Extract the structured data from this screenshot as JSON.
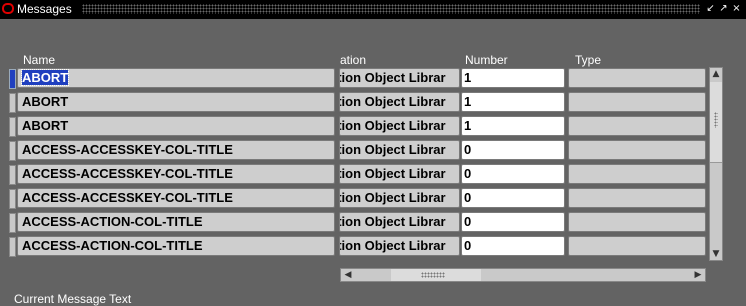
{
  "window": {
    "title": "Messages",
    "minimize_glyph": "↙",
    "maximize_glyph": "↗",
    "close_glyph": "×"
  },
  "table": {
    "headers": {
      "name": "Name",
      "application": "ation",
      "number": "Number",
      "type": "Type"
    },
    "rows": [
      {
        "name": "ABORT",
        "application": "ation Object Librar",
        "number": "1",
        "type": ""
      },
      {
        "name": "ABORT",
        "application": "ation Object Librar",
        "number": "1",
        "type": ""
      },
      {
        "name": "ABORT",
        "application": "ation Object Librar",
        "number": "1",
        "type": ""
      },
      {
        "name": "ACCESS-ACCESSKEY-COL-TITLE",
        "application": "ation Object Librar",
        "number": "0",
        "type": ""
      },
      {
        "name": "ACCESS-ACCESSKEY-COL-TITLE",
        "application": "ation Object Librar",
        "number": "0",
        "type": ""
      },
      {
        "name": "ACCESS-ACCESSKEY-COL-TITLE",
        "application": "ation Object Librar",
        "number": "0",
        "type": ""
      },
      {
        "name": "ACCESS-ACTION-COL-TITLE",
        "application": "ation Object Librar",
        "number": "0",
        "type": ""
      },
      {
        "name": "ACCESS-ACTION-COL-TITLE",
        "application": "ation Object Librar",
        "number": "0",
        "type": ""
      }
    ]
  },
  "scrollbars": {
    "up_glyph": "▲",
    "down_glyph": "▼",
    "left_glyph": "◀",
    "right_glyph": "▶"
  },
  "bottom": {
    "label": "Current Message Text"
  },
  "colors": {
    "background": "#636363",
    "selection": "#1f3fbf",
    "field": "#cecece"
  }
}
